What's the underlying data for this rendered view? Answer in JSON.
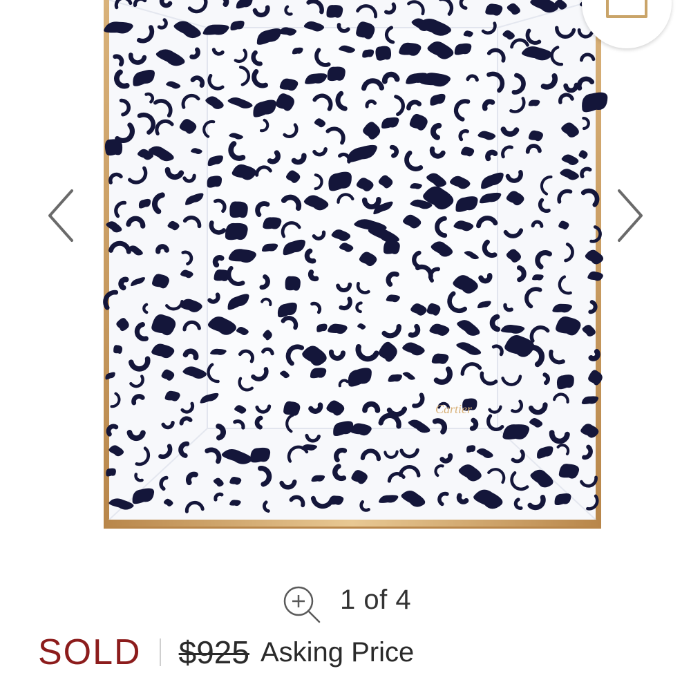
{
  "gallery": {
    "image_alt": "Cartier leopard print porcelain tray",
    "brand_mark": "Cartier",
    "prev_icon": "chevron-left-icon",
    "next_icon": "chevron-right-icon",
    "bag_icon": "shopping-bag-icon",
    "colors": {
      "spots": "#14163a",
      "tray_white": "#f7f8fb",
      "gold_rim": "#c9a469"
    }
  },
  "pager": {
    "zoom_icon": "zoom-in-icon",
    "text": "1 of 4",
    "current": 1,
    "total": 4
  },
  "listing": {
    "status": "SOLD",
    "original_price": "$925",
    "price_label": "Asking Price",
    "colors": {
      "sold": "#8c1c1c",
      "text": "#2a2a2a"
    }
  }
}
